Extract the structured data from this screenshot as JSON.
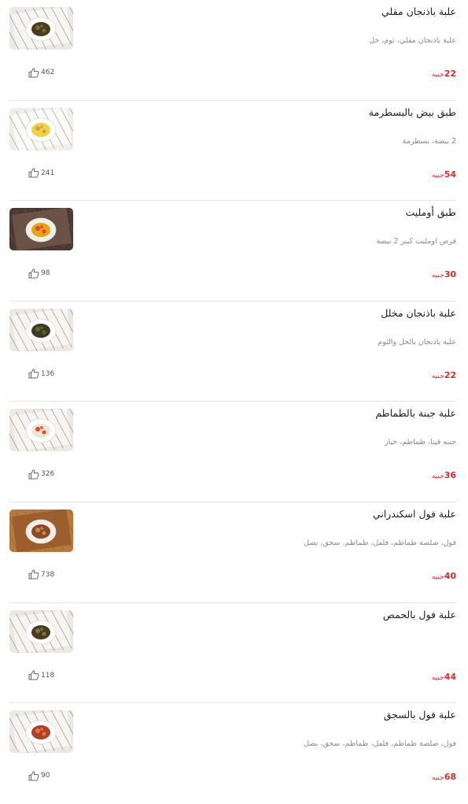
{
  "currency": "جنيه",
  "items": [
    {
      "name": "علبة باذنجان مقلي",
      "description": "علبة باذنجان مقلي، ثوم، خل",
      "price": "22",
      "likes": "462",
      "image": "fried-eggplant-photo"
    },
    {
      "name": "طبق بيض بالبسطرمة",
      "description": "2 بيضة، بسطرمة",
      "price": "54",
      "likes": "241",
      "image": "eggs-pastrami-photo"
    },
    {
      "name": "طبق أومليت",
      "description": "قرص اومليت كبير 2 بيضة",
      "price": "30",
      "likes": "98",
      "image": "omelette-photo"
    },
    {
      "name": "علبة باذنجان مخلل",
      "description": "علبة باذنجان بالخل والثوم",
      "price": "22",
      "likes": "136",
      "image": "pickled-eggplant-photo"
    },
    {
      "name": "علبة جبنة بالطماطم",
      "description": "جبنه فيتا، طماطم، خيار",
      "price": "36",
      "likes": "326",
      "image": "cheese-tomato-photo"
    },
    {
      "name": "علبة فول اسكندراني",
      "description": "فول، صلصة طماطم، فلفل، طماطم، سجق، بصل",
      "price": "40",
      "likes": "738",
      "image": "foul-alexandrian-photo"
    },
    {
      "name": "علبة فول بالحمص",
      "description": "",
      "price": "44",
      "likes": "118",
      "image": "foul-chickpeas-photo"
    },
    {
      "name": "علبة فول بالسجق",
      "description": "فول، صلصة طماطم، فلفل، طماطم، سجق، بصل",
      "price": "68",
      "likes": "90",
      "image": "foul-sausage-photo"
    }
  ],
  "colors": {
    "price": "#d32f2f",
    "divider": "#e6e6e6",
    "description": "#8a8a8a"
  }
}
